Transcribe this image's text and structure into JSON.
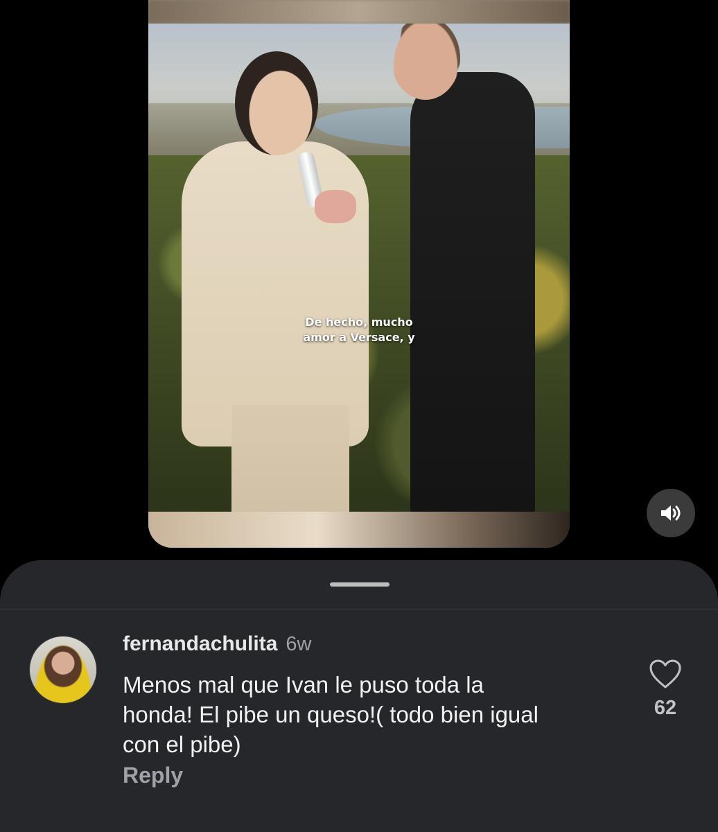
{
  "video": {
    "caption_line1": "De hecho, mucho",
    "caption_line2": "amor a Versace, y",
    "sound_icon": "speaker-volume-icon"
  },
  "comment": {
    "username": "fernandachulita",
    "time": "6w",
    "text_line1": "Menos mal que Ivan le puso toda la",
    "text_line2": "honda! El pibe un queso!( todo bien igual",
    "text_line3": "con el pibe)",
    "reply_label": "Reply",
    "like_icon": "heart-outline-icon",
    "like_count": "62"
  },
  "colors": {
    "background": "#000000",
    "sheet": "#25272b",
    "text_primary": "#f2f2f2",
    "text_secondary": "#9ea2a8"
  }
}
